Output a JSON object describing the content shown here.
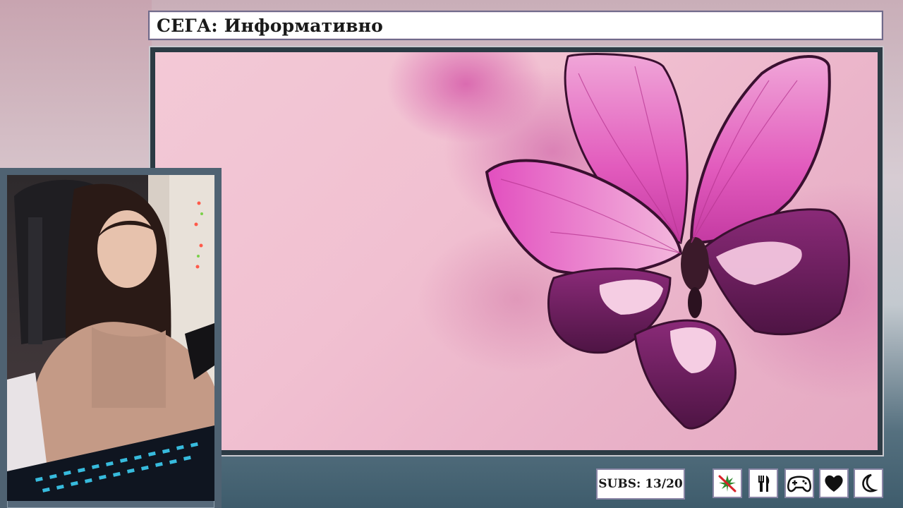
{
  "stream": {
    "title": "СЕГА: Информативно"
  },
  "counters": {
    "subs_label": "SUBS: 13/20"
  },
  "status_icons": [
    {
      "name": "no-weed-icon"
    },
    {
      "name": "fork-knife-icon"
    },
    {
      "name": "gamepad-icon"
    },
    {
      "name": "heart-icon"
    },
    {
      "name": "moon-icon"
    }
  ],
  "colors": {
    "frame_border": "#6f6a8a",
    "background_pink": "#f1c0d1",
    "butterfly_pink": "#e04fb8",
    "butterfly_dark": "#5a1a4a"
  }
}
